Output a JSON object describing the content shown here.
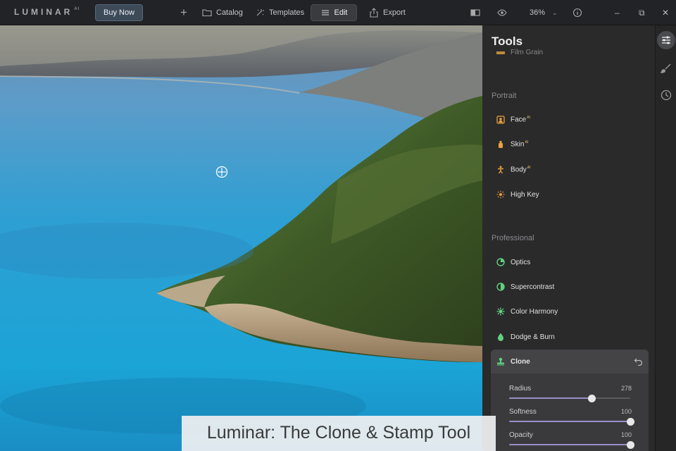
{
  "app": {
    "logo": "LUMINAR",
    "logo_suffix": "AI"
  },
  "toolbar": {
    "buy_now": "Buy Now",
    "catalog": "Catalog",
    "templates": "Templates",
    "edit": "Edit",
    "export": "Export",
    "zoom": "36%"
  },
  "panel": {
    "title": "Tools",
    "film_grain": "Film Grain",
    "sections": {
      "portrait": "Portrait",
      "professional": "Professional"
    },
    "portrait_tools": [
      {
        "label": "Face",
        "ai": "AI",
        "icon": "face-icon"
      },
      {
        "label": "Skin",
        "ai": "AI",
        "icon": "skin-icon"
      },
      {
        "label": "Body",
        "ai": "AI",
        "icon": "body-icon"
      },
      {
        "label": "High Key",
        "ai": "",
        "icon": "highkey-icon"
      }
    ],
    "professional_tools": [
      {
        "label": "Optics",
        "icon": "optics-icon"
      },
      {
        "label": "Supercontrast",
        "icon": "supercontrast-icon"
      },
      {
        "label": "Color Harmony",
        "icon": "color-harmony-icon"
      },
      {
        "label": "Dodge & Burn",
        "icon": "dodge-burn-icon"
      }
    ],
    "clone": {
      "label": "Clone",
      "sliders": [
        {
          "label": "Radius",
          "value": "278",
          "fraction": 0.68
        },
        {
          "label": "Softness",
          "value": "100",
          "fraction": 1.0
        },
        {
          "label": "Opacity",
          "value": "100",
          "fraction": 1.0
        }
      ]
    }
  },
  "caption": "Luminar: The Clone & Stamp Tool",
  "colors": {
    "accent": "#9b8ec9",
    "portrait_icon": "#e8a23c",
    "professional_icon": "#5fd17f",
    "sea": "#2aa6d4"
  }
}
